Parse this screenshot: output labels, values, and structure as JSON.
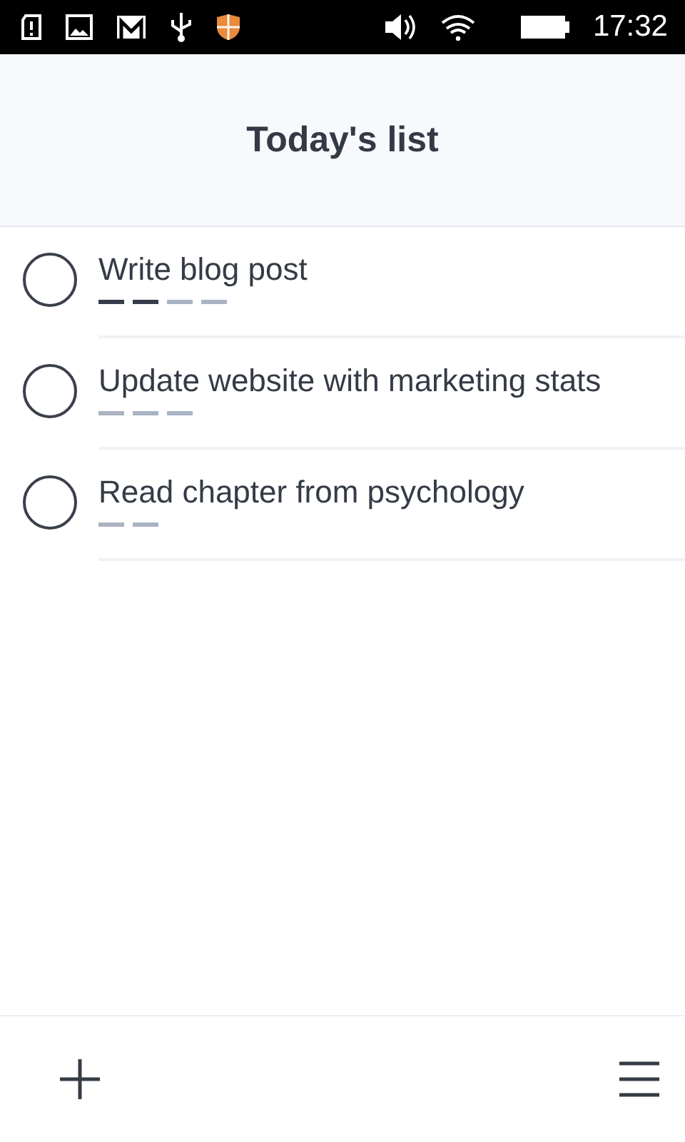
{
  "status_bar": {
    "time": "17:32"
  },
  "header": {
    "title": "Today's list"
  },
  "tasks": [
    {
      "title": "Write blog post",
      "checked": false,
      "sessions": [
        {
          "done": true
        },
        {
          "done": true
        },
        {
          "done": false
        },
        {
          "done": false
        }
      ]
    },
    {
      "title": "Update website with marketing stats",
      "checked": false,
      "sessions": [
        {
          "done": false
        },
        {
          "done": false
        },
        {
          "done": false
        }
      ]
    },
    {
      "title": "Read chapter from psychology",
      "checked": false,
      "sessions": [
        {
          "done": false
        },
        {
          "done": false
        }
      ]
    }
  ]
}
